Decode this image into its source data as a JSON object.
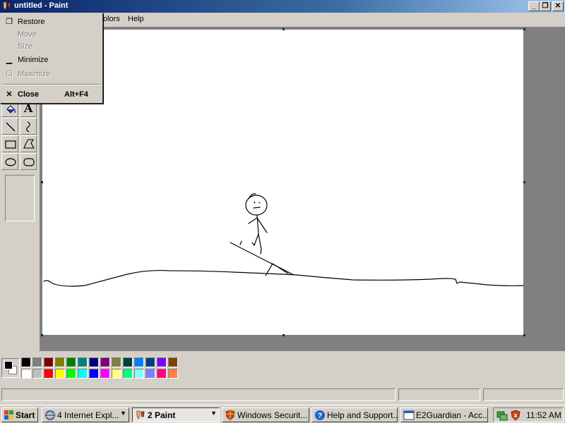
{
  "window": {
    "title": "untitled - Paint",
    "menus": [
      "olors",
      "Help"
    ]
  },
  "system_menu": {
    "items": [
      {
        "label": "Restore",
        "shortcut": "",
        "enabled": true
      },
      {
        "label": "Move",
        "shortcut": "",
        "enabled": false
      },
      {
        "label": "Size",
        "shortcut": "",
        "enabled": false
      },
      {
        "label": "Minimize",
        "shortcut": "",
        "enabled": true
      },
      {
        "label": "Maximize",
        "shortcut": "",
        "enabled": false
      },
      {
        "label": "Close",
        "shortcut": "Alt+F4",
        "enabled": true
      }
    ]
  },
  "toolbox": {
    "tools": [
      "fill-with-color",
      "text",
      "line",
      "curve",
      "rectangle",
      "polygon",
      "ellipse",
      "rounded-rectangle"
    ],
    "text_tool_glyph": "A"
  },
  "palette": {
    "foreground": "#000000",
    "background": "#ffffff",
    "top_row": [
      "#000000",
      "#808080",
      "#800000",
      "#808000",
      "#008000",
      "#008080",
      "#000080",
      "#800080",
      "#808040",
      "#004040",
      "#0080ff",
      "#004080",
      "#8000ff",
      "#804000"
    ],
    "bottom_row": [
      "#ffffff",
      "#c0c0c0",
      "#ff0000",
      "#ffff00",
      "#00ff00",
      "#00ffff",
      "#0000ff",
      "#ff00ff",
      "#ffff80",
      "#00ff80",
      "#80ffff",
      "#8080ff",
      "#ff0080",
      "#ff8040"
    ]
  },
  "taskbar": {
    "start_label": "Start",
    "tasks": [
      {
        "label": "4 Internet Expl...",
        "icon": "internet-explorer-icon",
        "active": false,
        "group": true
      },
      {
        "label": "2 Paint",
        "icon": "paint-icon",
        "active": true,
        "group": true
      },
      {
        "label": "Windows Securit...",
        "icon": "security-shield-icon",
        "active": false,
        "group": false
      },
      {
        "label": "Help and Support...",
        "icon": "help-icon",
        "active": false,
        "group": false
      },
      {
        "label": "E2Guardian - Acc...",
        "icon": "window-icon",
        "active": false,
        "group": false
      }
    ],
    "clock": "11:52 AM"
  }
}
